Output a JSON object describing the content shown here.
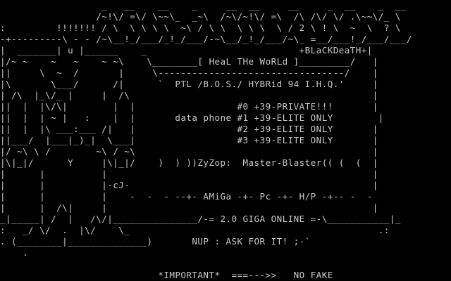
{
  "screen": {
    "foreground_color": "#c8c8c8",
    "background_color": "#000000",
    "lines": [
      "                  _   __    __    _     __  __     __     _  __    _  __",
      "                 /~!\\/ =\\/ \\~~\\_  _~\\  /~\\/~!\\/ =\\  /\\ /\\/ \\/ .\\~~\\/_ \\",
      ":         !!!!!!! / \\  \\ \\ \\ \\  ~\\ / \\ \\  \\ \\ \\  \\ / 2 \\ ! \\  ~  \\  ? \\",
      "-+---------\\ - - /~\\__!_/___/_!_/___/-~\\__/_!_/___/~\\_ =__/___!_/___/___/",
      "|  _______| u |______    _                           +BLaCKDeaTH+|",
      "|/~ ~    ~   ~    ~ ~\\    \\________[ HeaL THe WoRLd ]_________/   |",
      "||     \\  ~  /       |     \\---------------------------------/    |",
      "|\\       \\___/      /|      `  PTL /B.O.S./ HYBRid 94 I.H.Q.'     |",
      "| /\\  |_\\/_ |     |  /\\                                           |",
      "||  |  |\\/\\|        |  |                  #0 +39-PRIVATE!!!       |",
      "||  |  | ~ |   :    |  |       data phone #1 +39-ELITE ONLY        |",
      "||  |  |\\ ___:___ /|   |                  #2 +39-ELITE ONLY       |",
      "||___/  |___|_)_|  \\___|                  #3 +39-ELITE ONLY       |",
      "|/ ~\\ \\ /        ~\\ / ~\\                                          |",
      "|\\|_|/      Y     |\\|_|/    )  ) ))ZyZop:  Master-Blaster(( (  (  |",
      "|      |          |                                               |",
      "|      |          |-cJ-                                           |",
      "|      |          |    -  -  - --+- AMiGa -+- Pc -+- H/P -+-- -  -",
      "|      |  /\\|     |                                               |",
      "_|_____| /  |   /\\/|_______________/-= 2.0 GIGA ONLINE =-\\___________|_",
      ":   _/ \\/  .  |\\/    \\_                                            .:",
      ". (________|______________)       NUP : ASK FOR IT! ;-`",
      "    .",
      "",
      "                            *IMPORTANT*  ===--->>   NO FAKE"
    ]
  }
}
